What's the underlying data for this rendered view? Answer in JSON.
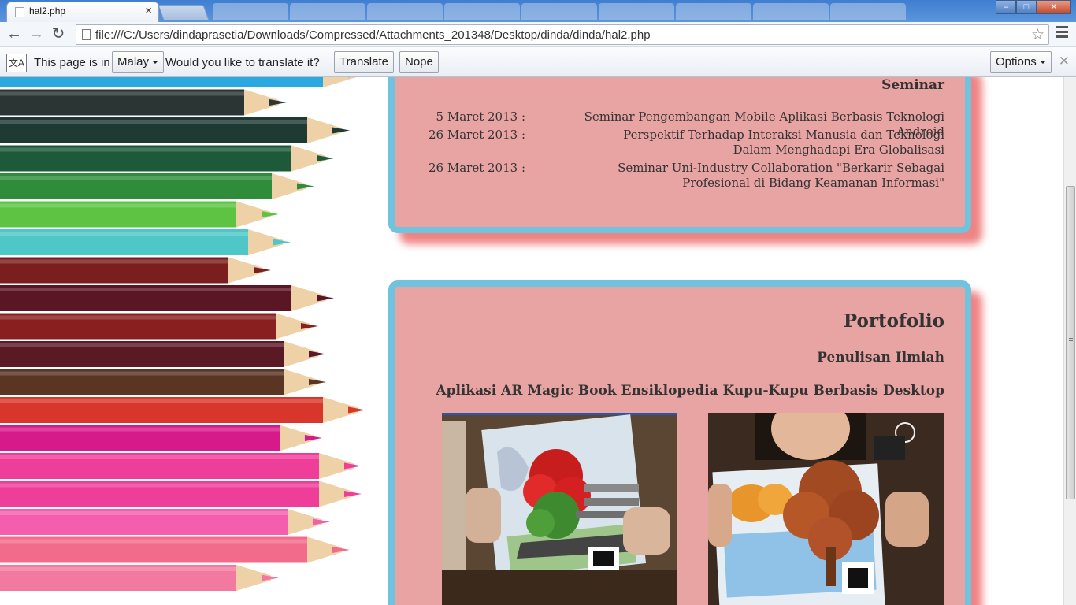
{
  "browser": {
    "tab_title": "hal2.php",
    "tab_close": "×",
    "url": "file:///C:/Users/dindaprasetia/Downloads/Compressed/Attachments_201348/Desktop/dinda/dinda/hal2.php",
    "back_icon": "←",
    "forward_icon": "→",
    "reload_icon": "↻",
    "star_icon": "☆",
    "win_minimize": "–",
    "win_maximize": "□",
    "win_close": "✕"
  },
  "infobar": {
    "icon_text": "文A",
    "prefix": "This page is in",
    "language": "Malay",
    "question": "Would you like to translate it?",
    "translate_label": "Translate",
    "nope_label": "Nope",
    "options_label": "Options",
    "close": "✕"
  },
  "seminar": {
    "title": "Seminar",
    "items": [
      {
        "date": "5 Maret 2013 :",
        "desc": "Seminar Pengembangan Mobile Aplikasi Berbasis Teknologi Android"
      },
      {
        "date": "26 Maret 2013 :",
        "desc": "Perspektif Terhadap Interaksi Manusia dan Teknologi Dalam Menghadapi Era Globalisasi"
      },
      {
        "date": "26 Maret 2013 :",
        "desc": "Seminar Uni-Industry Collaboration \"Berkarir Sebagai Profesional di Bidang Keamanan Informasi\""
      }
    ]
  },
  "portfolio": {
    "title": "Portofolio",
    "subtitle": "Penulisan Ilmiah",
    "app_title": "Aplikasi AR Magic Book Ensiklopedia Kupu-Kupu Berbasis Desktop"
  },
  "colors": {
    "card_bg": "#e8a4a3",
    "card_border": "#6fc3de",
    "card_shadow": "#eb6e6e"
  }
}
